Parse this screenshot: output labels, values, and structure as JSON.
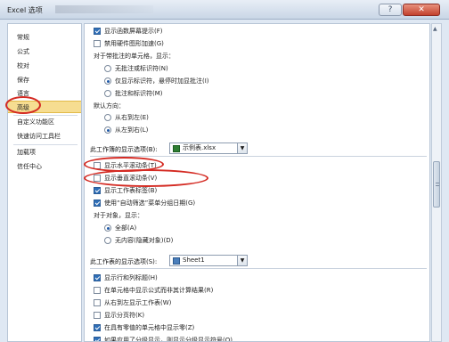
{
  "window": {
    "title": "Excel 选项",
    "help": "?",
    "close": "✕"
  },
  "sidebar": {
    "items": [
      {
        "label": "常规"
      },
      {
        "label": "公式"
      },
      {
        "label": "校对"
      },
      {
        "label": "保存"
      },
      {
        "label": "语言"
      },
      {
        "label": "高级"
      },
      {
        "label": "自定义功能区"
      },
      {
        "label": "快速访问工具栏"
      },
      {
        "label": "加载项"
      },
      {
        "label": "信任中心"
      }
    ],
    "selected": "高级"
  },
  "options": {
    "show_function_tips": {
      "label": "显示函数屏幕提示(F)",
      "checked": true
    },
    "disable_hw_accel": {
      "label": "禁用硬件图形加速(G)",
      "checked": false
    },
    "comments_heading": "对于带批注的单元格，显示：",
    "no_comments": {
      "label": "无批注或标识符(N)",
      "checked": false
    },
    "indicator_only": {
      "label": "仅显示标识符，悬停时加显批注(I)",
      "checked": true
    },
    "comments_and_indicators": {
      "label": "批注和标识符(M)",
      "checked": false
    },
    "direction_heading": "默认方向：",
    "rtl": {
      "label": "从右到左(E)",
      "checked": false
    },
    "ltr": {
      "label": "从左到右(L)",
      "checked": true
    }
  },
  "workbook_section": {
    "title": "此工作簿的显示选项(B):",
    "file": "示例表.xlsx",
    "hscroll": {
      "label": "显示水平滚动条(T)",
      "checked": false
    },
    "vscroll": {
      "label": "显示垂直滚动条(V)",
      "checked": false
    },
    "sheet_tabs": {
      "label": "显示工作表标签(B)",
      "checked": true
    },
    "group_dates": {
      "label": "使用“自动筛选”菜单分组日期(G)",
      "checked": true
    },
    "objects_heading": "对于对象，显示：",
    "all": {
      "label": "全部(A)",
      "checked": true
    },
    "nothing": {
      "label": "无内容(隐藏对象)(D)",
      "checked": false
    }
  },
  "worksheet_section": {
    "title": "此工作表的显示选项(S):",
    "sheet": "Sheet1",
    "row_col_headers": {
      "label": "显示行和列标题(H)",
      "checked": true
    },
    "formulas": {
      "label": "在单元格中显示公式而非其计算结果(R)",
      "checked": false
    },
    "rtl_sheet": {
      "label": "从右到左显示工作表(W)",
      "checked": false
    },
    "page_breaks": {
      "label": "显示分页符(K)",
      "checked": false
    },
    "zero_values": {
      "label": "在具有零值的单元格中显示零(Z)",
      "checked": true
    },
    "outline": {
      "label": "如果应用了分级显示，则显示分级显示符号(O)",
      "checked": true
    }
  },
  "colors": {
    "accent": "#2f6fb8",
    "selected_nav": "#f6dd91",
    "highlight_ring": "#d42a22"
  }
}
